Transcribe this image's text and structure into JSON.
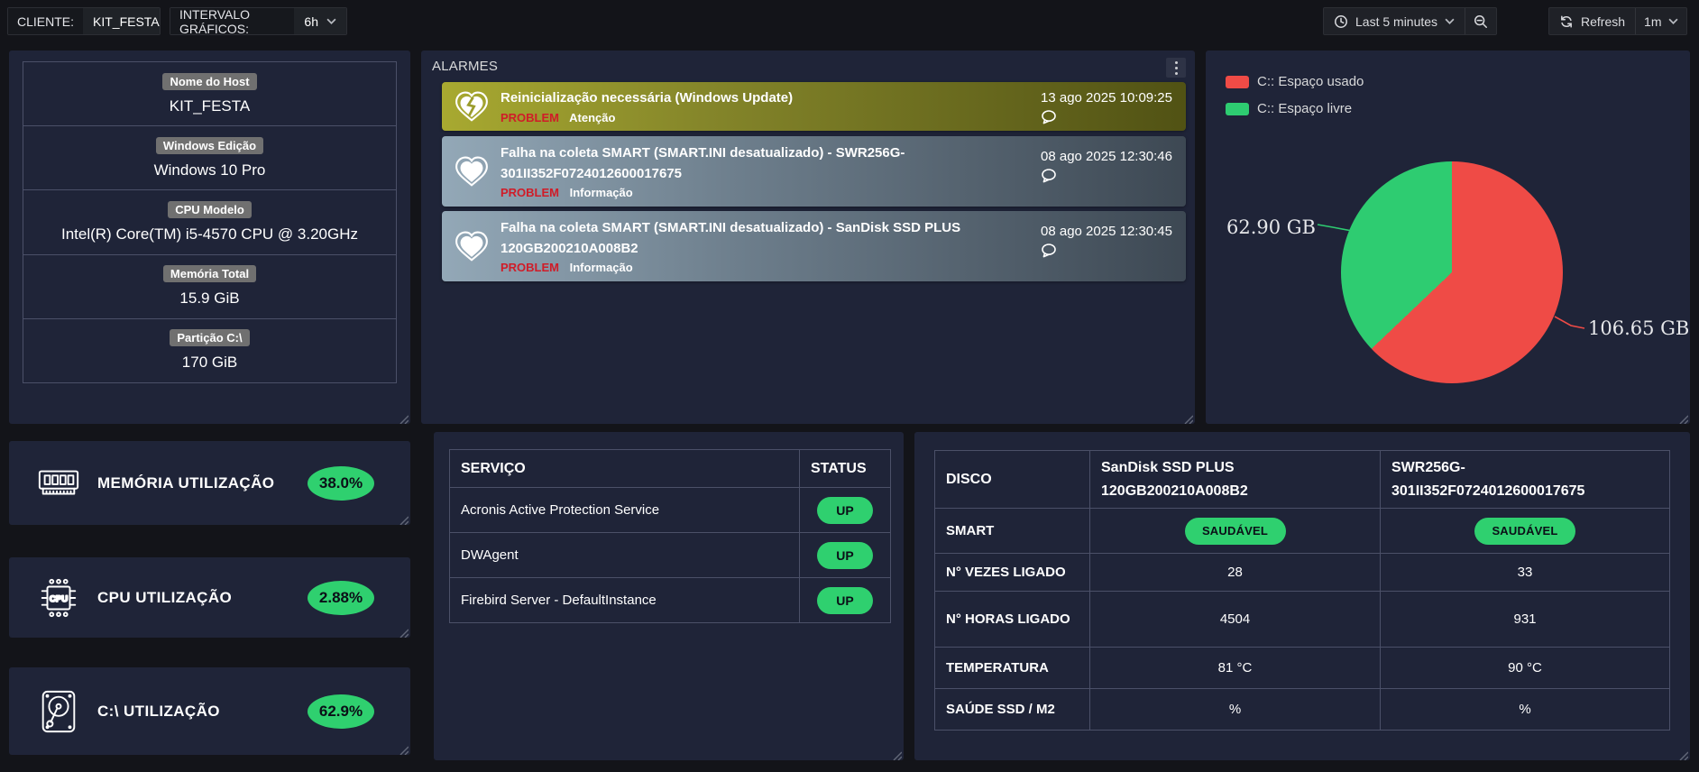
{
  "topbar": {
    "client_label": "CLIENTE:",
    "client_value": "KIT_FESTA",
    "interval_label": "INTERVALO GRÁFICOS:",
    "interval_value": "6h",
    "time_range": "Last 5 minutes",
    "refresh_label": "Refresh",
    "refresh_interval": "1m"
  },
  "icons": {
    "time_range": "clock-icon",
    "zoom_out": "magnifier-minus-icon",
    "refresh": "circular-arrows-icon",
    "caret": "chevron-down-icon",
    "alarm_warning": "broken-heart-icon",
    "alarm_info": "heart-icon",
    "comments": "speech-bubble-icon",
    "memory": "ram-stick-icon",
    "cpu": "cpu-chip-icon",
    "disk": "hard-drive-icon",
    "panel_menu": "kebab-dots-icon",
    "resize": "diagonal-grip-icon"
  },
  "host_info": {
    "rows": [
      {
        "label": "Nome do Host",
        "value": "KIT_FESTA"
      },
      {
        "label": "Windows Edição",
        "value": "Windows 10 Pro"
      },
      {
        "label": "CPU Modelo",
        "value": "Intel(R) Core(TM) i5-4570 CPU @ 3.20GHz"
      },
      {
        "label": "Memória Total",
        "value": "15.9 GiB"
      },
      {
        "label": "Partição C:\\",
        "value": "170 GiB"
      }
    ]
  },
  "alarms": {
    "title": "ALARMES",
    "items": [
      {
        "title": "Reinicialização necessária (Windows Update)",
        "status": "PROBLEM",
        "severity": "Atenção",
        "time": "13 ago 2025 10:09:25",
        "level": "warning"
      },
      {
        "title": "Falha na coleta SMART (SMART.INI desatualizado) - SWR256G-301II352F0724012600017675",
        "status": "PROBLEM",
        "severity": "Informação",
        "time": "08 ago 2025 12:30:46",
        "level": "info"
      },
      {
        "title": "Falha na coleta SMART (SMART.INI desatualizado) - SanDisk SSD PLUS 120GB200210A008B2",
        "status": "PROBLEM",
        "severity": "Informação",
        "time": "08 ago 2025 12:30:45",
        "level": "info"
      }
    ]
  },
  "chart_data": {
    "type": "pie",
    "title": "C: disk space",
    "labels": [
      "C:: Espaço usado",
      "C:: Espaço livre"
    ],
    "values": [
      106.65,
      62.9
    ],
    "unit": "GB",
    "value_labels": [
      "106.65 GB",
      "62.90 GB"
    ],
    "colors": [
      "#ef4b46",
      "#2ecc71"
    ],
    "legend_position": "top-left"
  },
  "stats": {
    "items": [
      {
        "label": "MEMÓRIA UTILIZAÇÃO",
        "value": "38.0%"
      },
      {
        "label": "CPU UTILIZAÇÃO",
        "value": "2.88%"
      },
      {
        "label": "C:\\ UTILIZAÇÃO",
        "value": "62.9%"
      }
    ]
  },
  "services": {
    "col_service": "SERVIÇO",
    "col_status": "STATUS",
    "rows": [
      {
        "name": "Acronis Active Protection Service",
        "status": "UP"
      },
      {
        "name": "DWAgent",
        "status": "UP"
      },
      {
        "name": "Firebird Server - DefaultInstance",
        "status": "UP"
      }
    ]
  },
  "disks": {
    "col_label": "DISCO",
    "columns": [
      "SanDisk SSD PLUS 120GB200210A008B2",
      "SWR256G-301II352F0724012600017675"
    ],
    "rows": [
      {
        "label": "SMART",
        "values": [
          "SAUDÁVEL",
          "SAUDÁVEL"
        ],
        "kind": "pill"
      },
      {
        "label": "N° VEZES LIGADO",
        "values": [
          "28",
          "33"
        ],
        "kind": "text"
      },
      {
        "label": "N° HORAS LIGADO",
        "values": [
          "4504",
          "931"
        ],
        "kind": "text"
      },
      {
        "label": "TEMPERATURA",
        "values": [
          "81 °C",
          "90 °C"
        ],
        "kind": "text"
      },
      {
        "label": "SAÚDE SSD / M2",
        "values": [
          "%",
          "%"
        ],
        "kind": "text"
      }
    ]
  },
  "colors": {
    "accent_green": "#2fd06f",
    "problem_red": "#d01c28",
    "panel_bg": "#1f2438",
    "page_bg": "#131419",
    "warning_alarm": "#a8a930",
    "info_alarm": "#93a8b7"
  }
}
